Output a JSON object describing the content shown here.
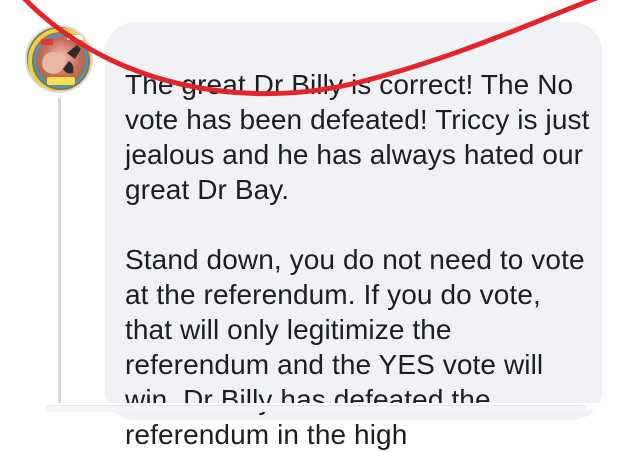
{
  "comment": {
    "avatar_icon": "profile-badge-icon",
    "paragraphs": [
      "The great Dr Billy is correct! The No vote has been defeated! Triccy is just jealous and he has always hated our great Dr Bay.",
      "Stand down, you do not need to vote at the referendum. If you do vote, that will only legitimize the referendum and the YES vote will win. Dr Billy has defeated the referendum in the high"
    ]
  },
  "colors": {
    "bubble": "#f0f2f5",
    "text": "#1c1e21",
    "annotation": "#e3242b"
  }
}
